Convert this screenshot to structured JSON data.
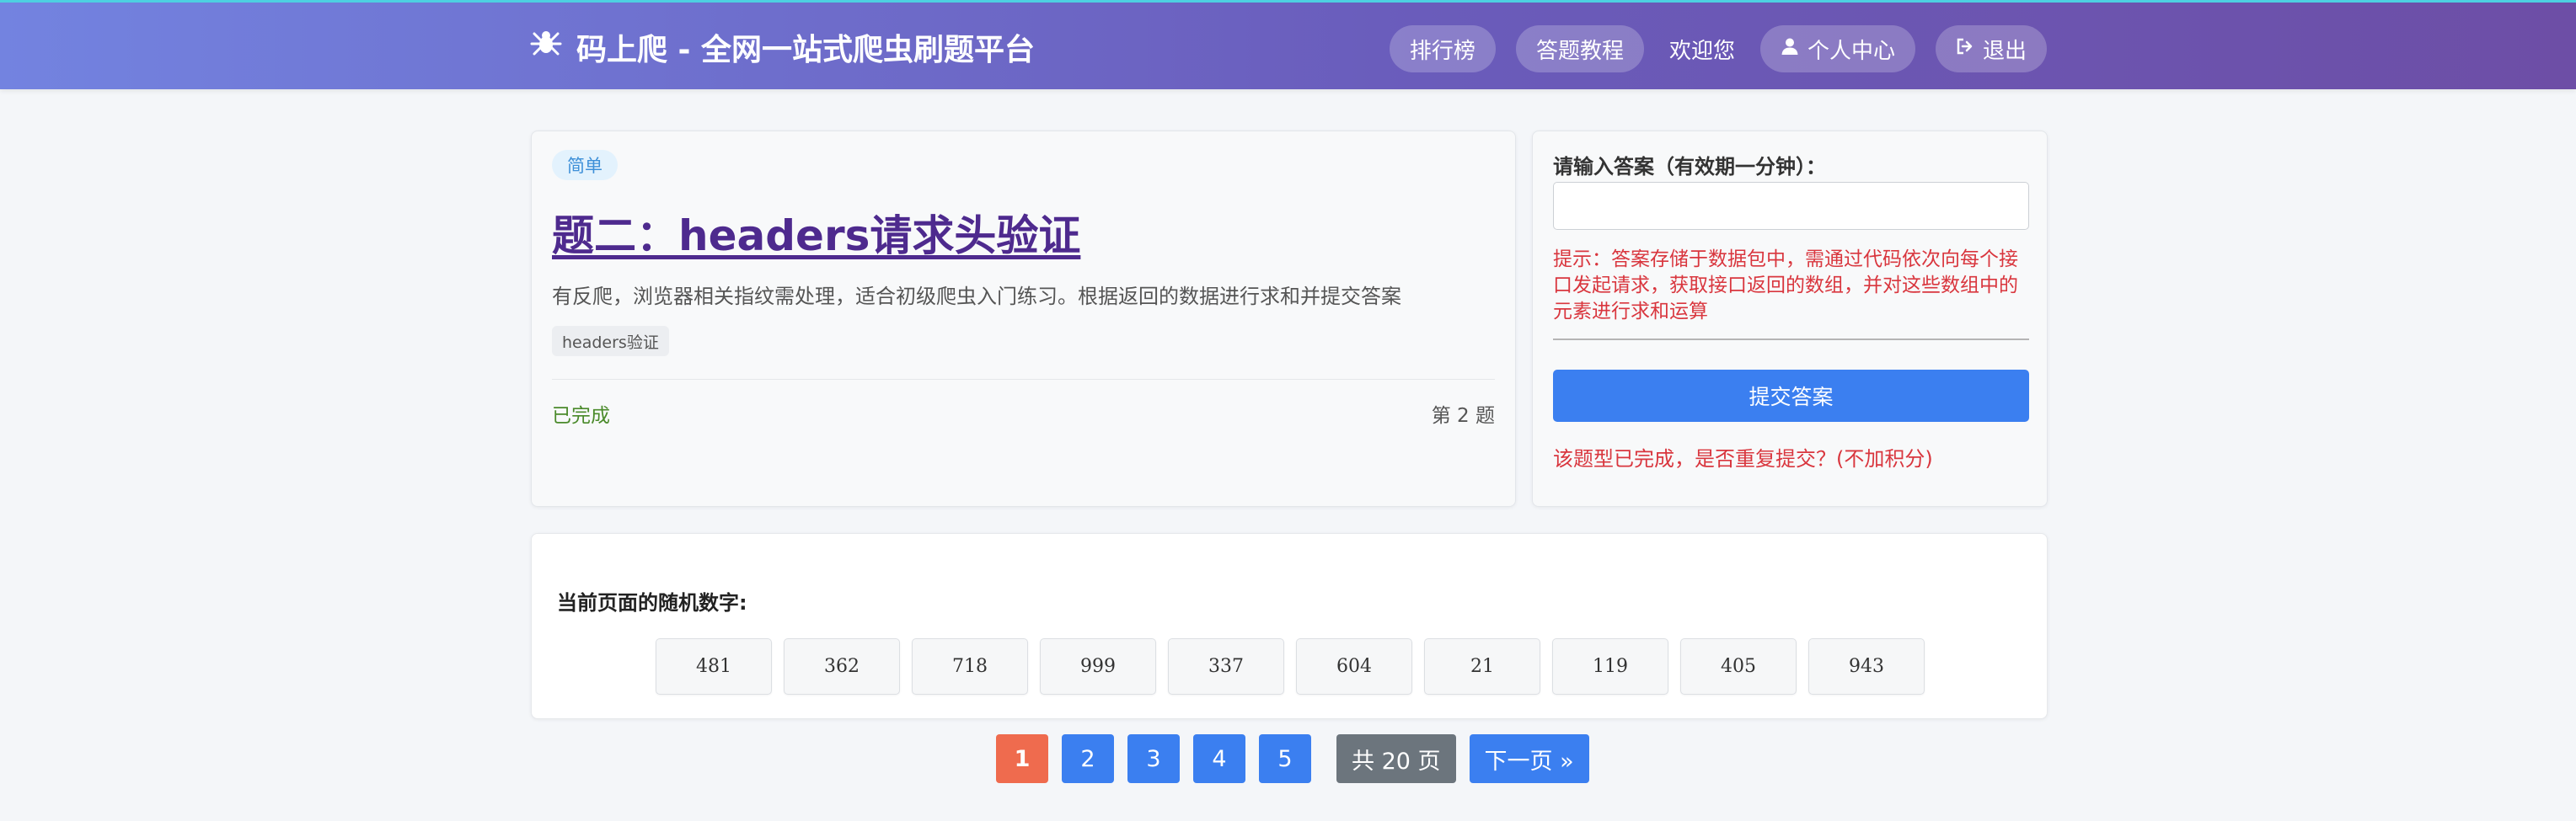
{
  "header": {
    "brand": "码上爬 - 全网一站式爬虫刷题平台",
    "nav": {
      "ranking": "排行榜",
      "tutorial": "答题教程",
      "welcome": "欢迎您",
      "profile": "个人中心",
      "logout": "退出"
    }
  },
  "task": {
    "difficulty": "简单",
    "title": "题二：headers请求头验证",
    "description": "有反爬，浏览器相关指纹需处理，适合初级爬虫入门练习。根据返回的数据进行求和并提交答案",
    "tag": "headers验证",
    "status": "已完成",
    "number": "第 2 题"
  },
  "answer": {
    "label": "请输入答案（有效期一分钟）：",
    "input_value": "",
    "hint": "提示：答案存储于数据包中，需通过代码依次向每个接口发起请求，获取接口返回的数组，并对这些数组中的元素进行求和运算",
    "submit_label": "提交答案",
    "repeat_message": "该题型已完成，是否重复提交？(不加积分)"
  },
  "random": {
    "label": "当前页面的随机数字:",
    "numbers": [
      "481",
      "362",
      "718",
      "999",
      "337",
      "604",
      "21",
      "119",
      "405",
      "943"
    ]
  },
  "pagination": {
    "pages": [
      "1",
      "2",
      "3",
      "4",
      "5"
    ],
    "current": "1",
    "total": "共 20 页",
    "next": "下一页 »"
  },
  "colors": {
    "header_gradient_start": "#7383e0",
    "header_gradient_end": "#6d4ea6",
    "primary": "#3b7ff0",
    "active_page": "#ef6b4e",
    "danger": "#d9363e",
    "success": "#4a8a2a",
    "title": "#4e2a8e"
  },
  "icons": {
    "brand": "spider-icon",
    "profile": "user-icon",
    "logout": "sign-out-icon"
  }
}
